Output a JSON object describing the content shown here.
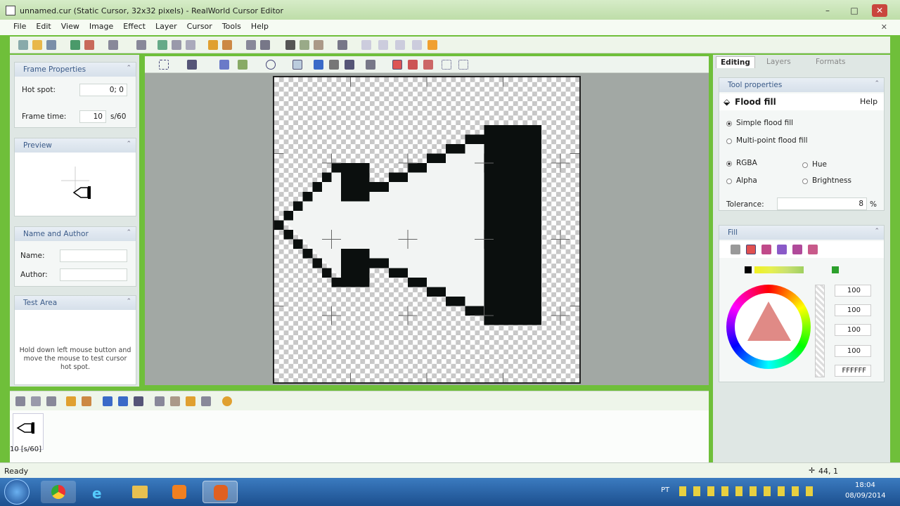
{
  "window": {
    "title": "unnamed.cur (Static Cursor, 32x32 pixels) - RealWorld Cursor Editor",
    "minimize": "–",
    "maximize": "□",
    "close": "✕",
    "mdi_close": "✕"
  },
  "menu": [
    "File",
    "Edit",
    "View",
    "Image",
    "Effect",
    "Layer",
    "Cursor",
    "Tools",
    "Help"
  ],
  "left": {
    "frame_properties": {
      "header": "Frame Properties",
      "hotspot_label": "Hot spot:",
      "hotspot_value": "0; 0",
      "frametime_label": "Frame time:",
      "frametime_value": "10",
      "frametime_unit": "s/60"
    },
    "preview": {
      "header": "Preview"
    },
    "name_author": {
      "header": "Name and Author",
      "name_label": "Name:",
      "author_label": "Author:"
    },
    "test_area": {
      "header": "Test Area",
      "hint": "Hold down left mouse button and move the mouse to test cursor hot spot."
    }
  },
  "right": {
    "tabs": [
      "Editing",
      "Layers",
      "Formats"
    ],
    "tool_properties": {
      "header": "Tool properties",
      "tool": "Flood fill",
      "help": "Help",
      "modes": [
        "Simple flood fill",
        "Multi-point flood fill"
      ],
      "channels": [
        "RGBA",
        "Hue",
        "Alpha",
        "Brightness"
      ],
      "tolerance_label": "Tolerance:",
      "tolerance_value": "8",
      "tolerance_unit": "%"
    },
    "fill": {
      "header": "Fill",
      "values": [
        "100",
        "100",
        "100",
        "100"
      ],
      "hex": "FFFFFF"
    }
  },
  "frames": [
    {
      "label": "10 [s/60]"
    }
  ],
  "status": {
    "text": "Ready",
    "coords": "44, 1"
  },
  "taskbar": {
    "lang": "PT",
    "time": "18:04",
    "date": "08/09/2014"
  },
  "colors": {
    "accent": "#3a5a88",
    "canvas_black": "#0b0f0e",
    "canvas_white": "#f2f4f3"
  }
}
